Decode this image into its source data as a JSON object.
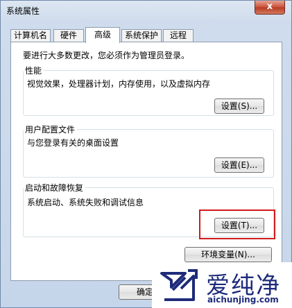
{
  "window": {
    "title": "系统属性",
    "close_glyph": "x"
  },
  "tabs": [
    {
      "label": "计算机名"
    },
    {
      "label": "硬件"
    },
    {
      "label": "高级"
    },
    {
      "label": "系统保护"
    },
    {
      "label": "远程"
    }
  ],
  "panel": {
    "intro": "要进行大多数更改，您必须作为管理员登录。",
    "performance": {
      "title": "性能",
      "desc": "视觉效果，处理器计划，内存使用，以及虚拟内存",
      "button": "设置(S)..."
    },
    "user_profiles": {
      "title": "用户配置文件",
      "desc": "与您登录有关的桌面设置",
      "button": "设置(E)..."
    },
    "startup_recovery": {
      "title": "启动和故障恢复",
      "desc": "系统启动、系统失败和调试信息",
      "button": "设置(T)..."
    },
    "env_button": "环境变量(N)..."
  },
  "footer": {
    "ok_button": "确定"
  },
  "watermark": {
    "name": "爱纯净",
    "url": "aichunjing.com"
  },
  "colors": {
    "highlight": "#d21a1a",
    "watermark": "#1e2b7a"
  }
}
